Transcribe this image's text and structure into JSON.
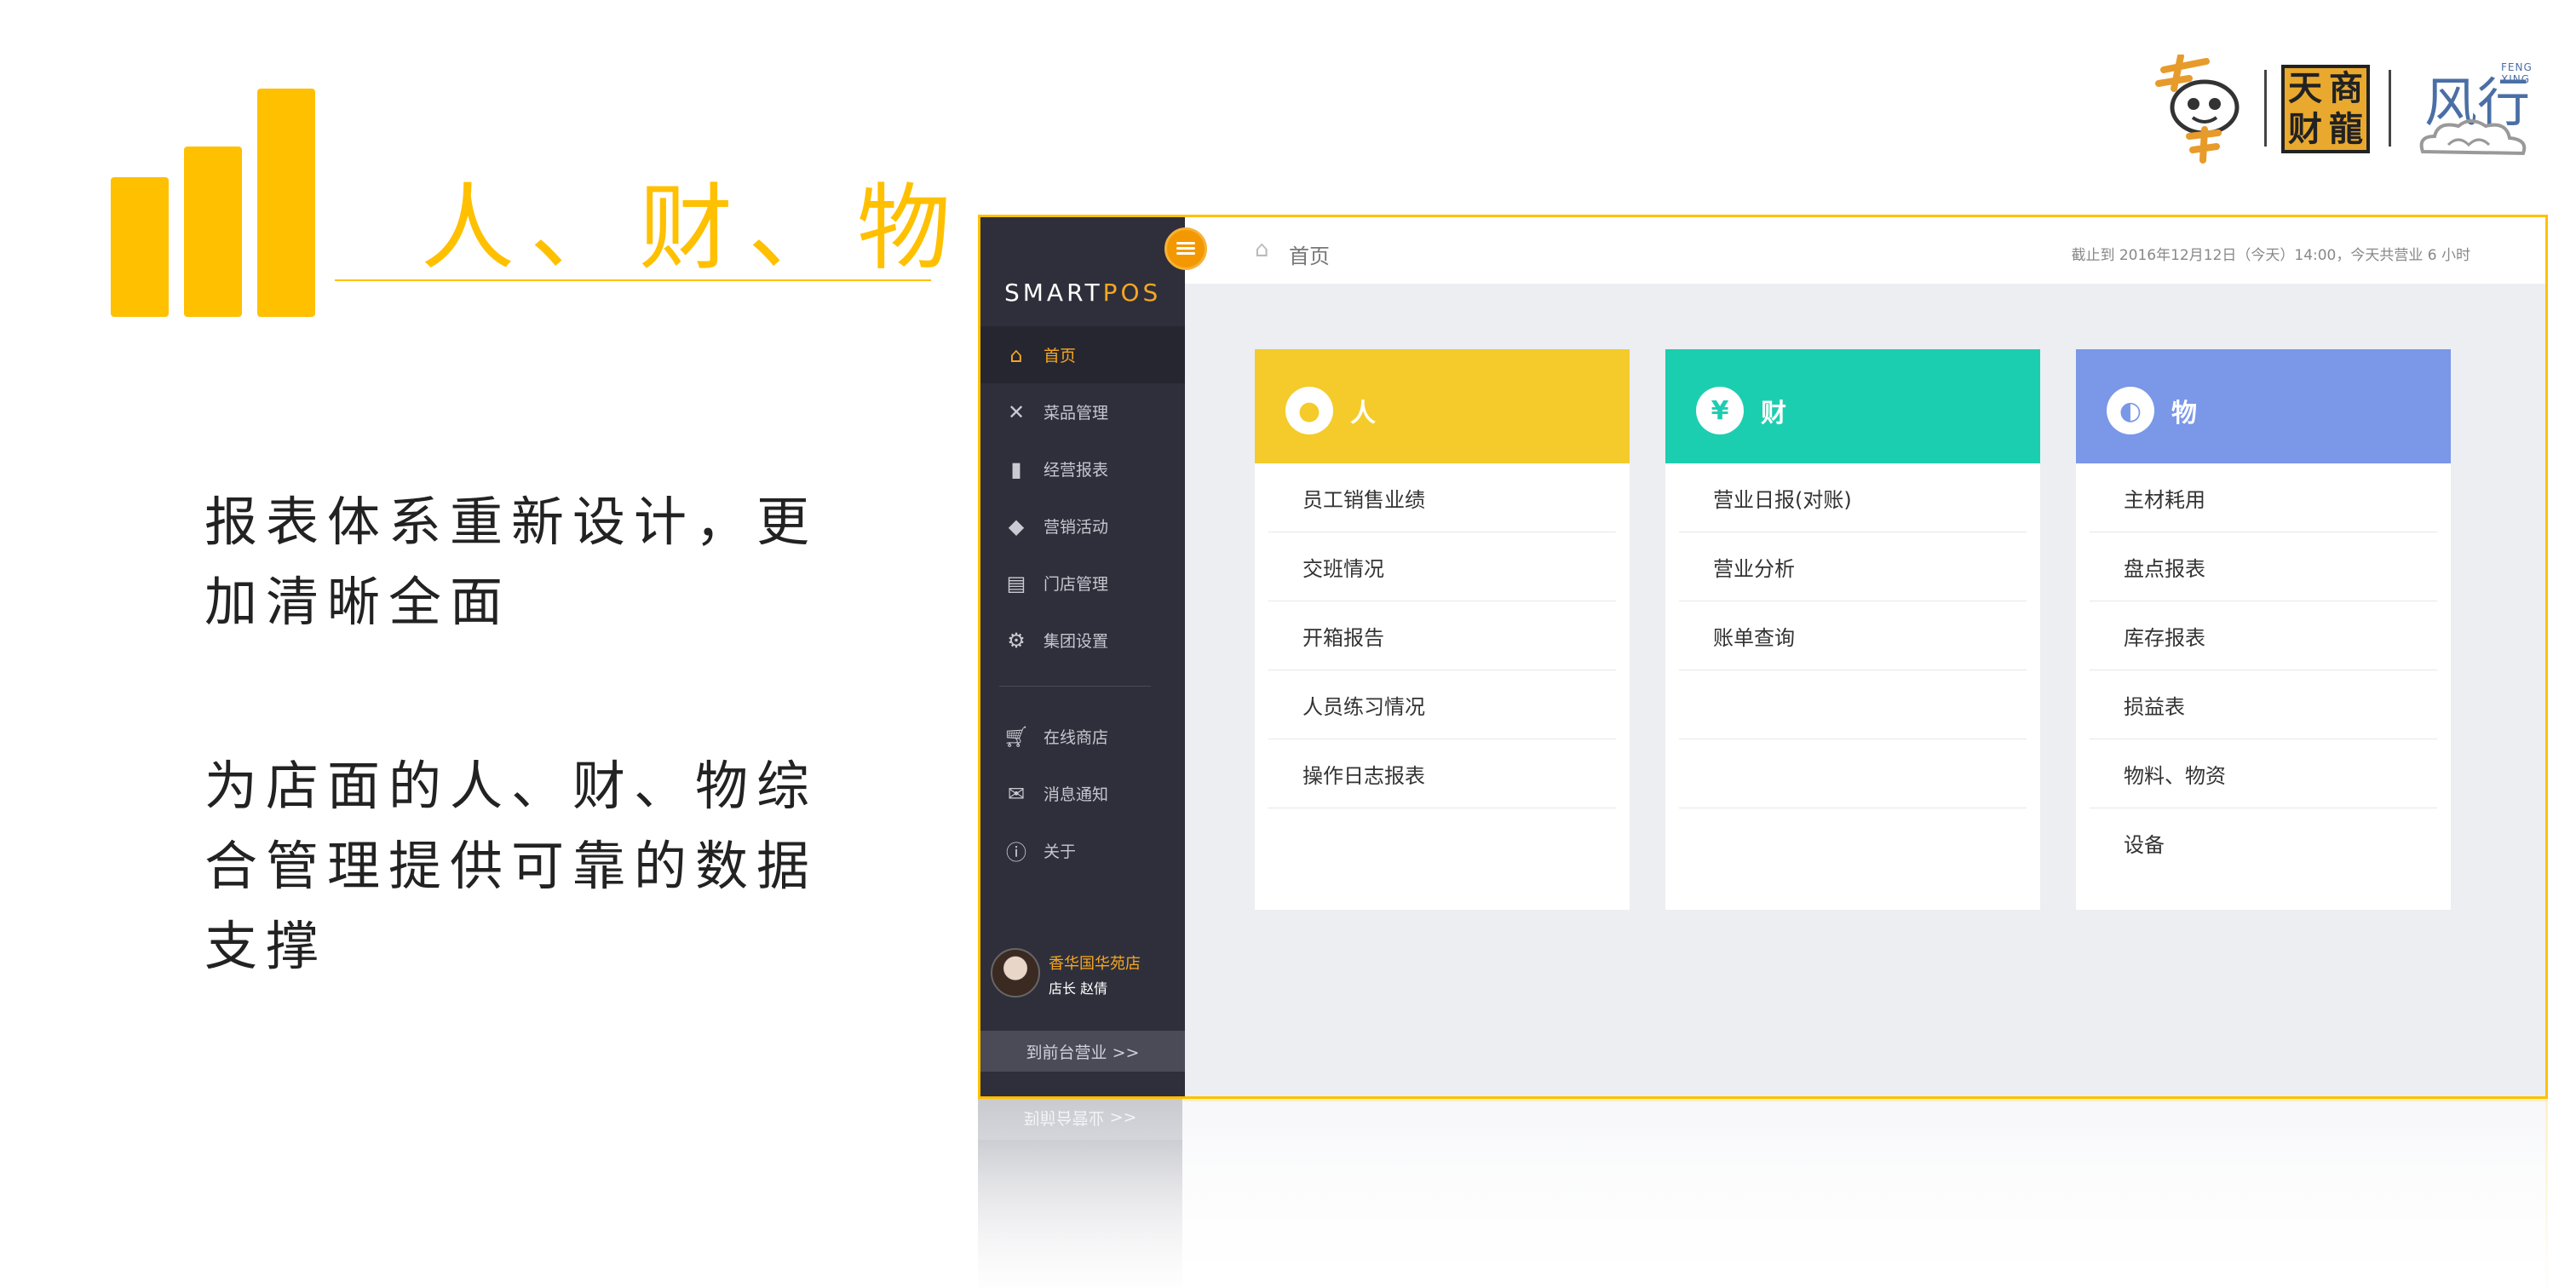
{
  "slide": {
    "title": "人、财、物",
    "desc1": "报表体系重新设计，更加清晰全面",
    "desc2": "为店面的人、财、物综合管理提供可靠的数据支撑"
  },
  "logos": {
    "b_chars": [
      "天",
      "商",
      "财",
      "龍"
    ],
    "c_text": "风行",
    "c_sub": "FENG XING"
  },
  "colors": {
    "accent": "#ffc000",
    "sidebar": "#2e2f3a",
    "orange": "#f5a623",
    "card_people": "#f4cb2a",
    "card_money": "#1cceb0",
    "card_goods": "#7a97e8"
  },
  "app": {
    "brand_prefix": "SMART",
    "brand_suffix": "POS",
    "nav": [
      {
        "label": "首页",
        "icon": "home-icon"
      },
      {
        "label": "菜品管理",
        "icon": "fork-knife-icon"
      },
      {
        "label": "经营报表",
        "icon": "bar-chart-icon"
      },
      {
        "label": "营销活动",
        "icon": "tag-icon"
      },
      {
        "label": "门店管理",
        "icon": "store-icon"
      },
      {
        "label": "集团设置",
        "icon": "gear-icon"
      },
      {
        "label": "在线商店",
        "icon": "cart-icon"
      },
      {
        "label": "消息通知",
        "icon": "mail-icon"
      },
      {
        "label": "关于",
        "icon": "info-icon"
      }
    ],
    "user": {
      "shop": "香华国华苑店",
      "role": "店长 赵倩"
    },
    "front_button": "到前台营业 >>",
    "breadcrumb": "首页",
    "timestamp": "截止到 2016年12月12日（今天）14:00，今天共营业 6 小时",
    "cards": [
      {
        "title": "人",
        "icon_glyph": "●",
        "items": [
          "员工销售业绩",
          "交班情况",
          "开箱报告",
          "人员练习情况",
          "操作日志报表"
        ]
      },
      {
        "title": "财",
        "icon_glyph": "¥",
        "items": [
          "营业日报(对账)",
          "营业分析",
          "账单查询"
        ]
      },
      {
        "title": "物",
        "icon_glyph": "◐",
        "items": [
          "主材耗用",
          "盘点报表",
          "库存报表",
          "损益表",
          "物料、物资",
          "设备"
        ]
      }
    ]
  }
}
